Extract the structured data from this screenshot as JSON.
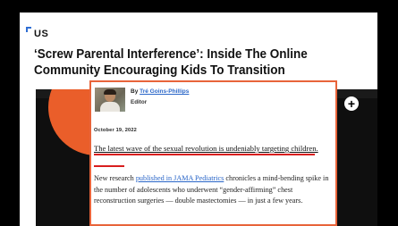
{
  "section": {
    "label": "US"
  },
  "article": {
    "headline": "‘Screw Parental Interference’: Inside The Online Community Encouraging Kids To Transition",
    "byline_prefix": "By",
    "author": "Tré Goins-Phillips",
    "role": "Editor",
    "date": "October 19, 2022",
    "lede": "The latest wave of the sexual revolution is undeniably targeting children.",
    "body_before_link": "New research ",
    "body_link": "published in JAMA Pediatrics",
    "body_after_link": " chronicles a mind-bending spike in the number of adolescents who underwent “gender-affirming” chest reconstruction surgeries — double mastectomies — in just a few years."
  },
  "controls": {
    "expand_icon": "plus-circle-icon",
    "expand_glyph": "+"
  },
  "colors": {
    "highlight_border": "#e8643a",
    "underline_red": "#d81e1e",
    "link_blue": "#2a66c8",
    "hero_accent": "#ea5e2a"
  }
}
